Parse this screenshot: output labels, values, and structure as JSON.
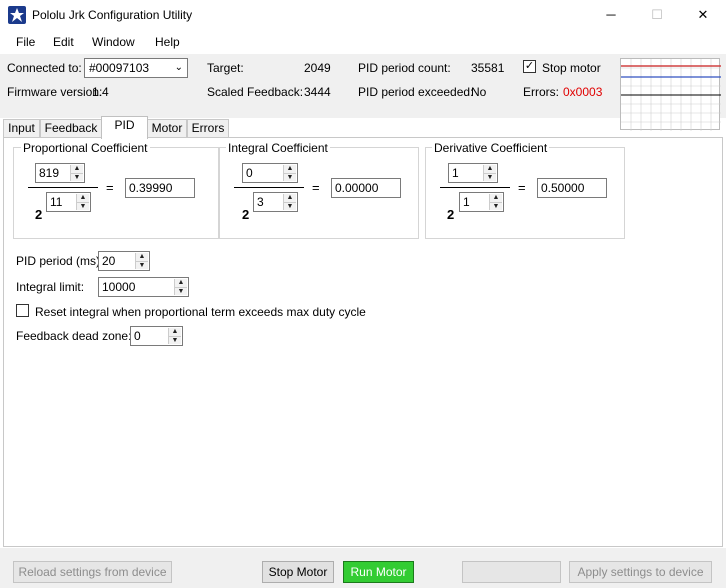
{
  "window": {
    "title": "Pololu Jrk Configuration Utility",
    "minimize": "─",
    "maximize": "☐",
    "close": "✕"
  },
  "menu": [
    "File",
    "Edit",
    "Window",
    "Help"
  ],
  "status": {
    "connected_label": "Connected to:",
    "device": "#00097103",
    "firmware_label": "Firmware version:",
    "firmware_value": "1.4",
    "target_label": "Target:",
    "target_value": "2049",
    "scaled_feedback_label": "Scaled Feedback:",
    "scaled_feedback_value": "3444",
    "pid_count_label": "PID period count:",
    "pid_count_value": "35581",
    "pid_exceeded_label": "PID period exceeded:",
    "pid_exceeded_value": "No",
    "stop_motor_label": "Stop motor",
    "stop_motor_checked": "✓",
    "errors_label": "Errors:",
    "errors_value": "0x0003",
    "errors_color": "#e00000"
  },
  "tabs": [
    "Input",
    "Feedback",
    "PID",
    "Motor",
    "Errors"
  ],
  "active_tab": "PID",
  "pid": {
    "proportional": {
      "label": "Proportional Coefficient",
      "multiplier": "819",
      "exponent": "11",
      "base": "2",
      "result": "0.39990"
    },
    "integral": {
      "label": "Integral Coefficient",
      "multiplier": "0",
      "exponent": "3",
      "base": "2",
      "result": "0.00000"
    },
    "derivative": {
      "label": "Derivative Coefficient",
      "multiplier": "1",
      "exponent": "1",
      "base": "2",
      "result": "0.50000"
    },
    "equals": "=",
    "period_label": "PID period (ms):",
    "period_value": "20",
    "integral_limit_label": "Integral limit:",
    "integral_limit_value": "10000",
    "reset_integral_label": "Reset integral when proportional term exceeds max duty cycle",
    "dead_zone_label": "Feedback dead zone:",
    "dead_zone_value": "0"
  },
  "buttons": {
    "reload": "Reload settings from device",
    "stop_motor": "Stop Motor",
    "run_motor": "Run Motor",
    "blank": "",
    "apply": "Apply settings to device"
  },
  "colors": {
    "run_motor": "#33cc33",
    "plot_red": "#d04040",
    "plot_blue": "#3050c0"
  },
  "icons": {
    "app": "pololu-star-icon",
    "dropdown": "chevron-down-icon",
    "spin_up": "▲",
    "spin_down": "▼"
  }
}
